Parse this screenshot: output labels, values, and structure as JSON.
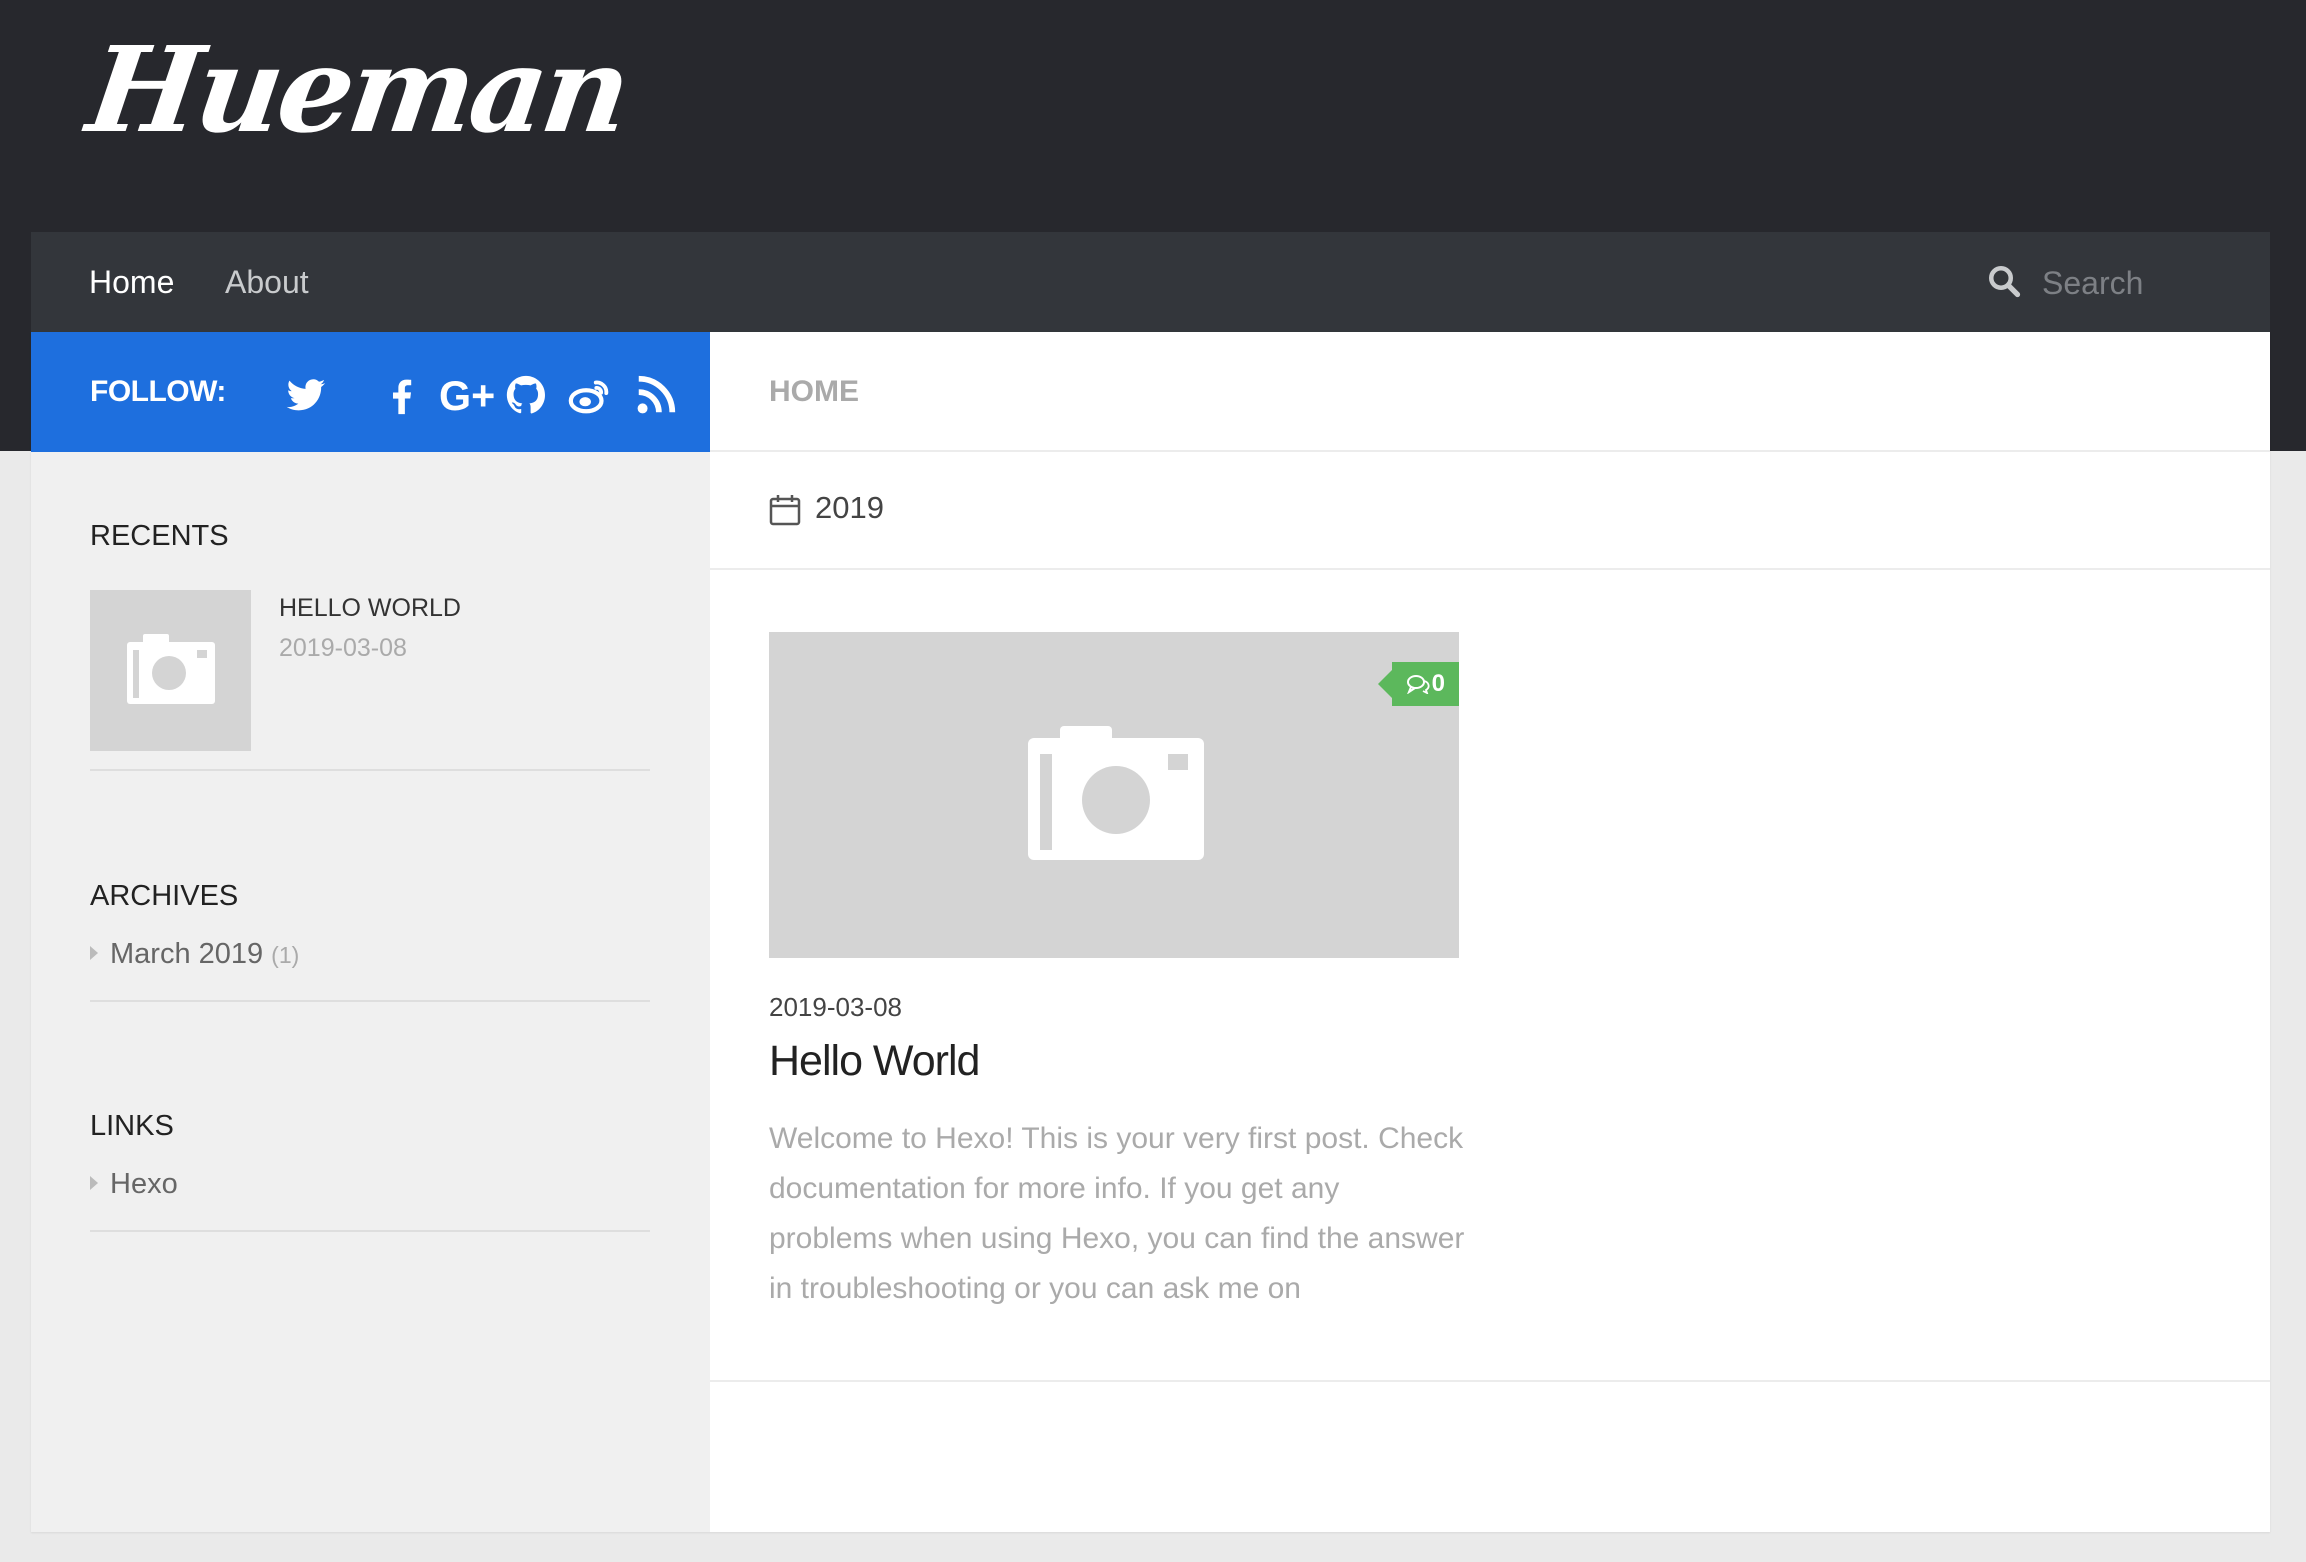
{
  "site": {
    "logo_text": "Hueman"
  },
  "nav": {
    "items": [
      {
        "label": "Home",
        "active": true
      },
      {
        "label": "About",
        "active": false
      }
    ],
    "search": {
      "placeholder": "Search",
      "value": ""
    }
  },
  "sidebar": {
    "follow": {
      "label": "FOLLOW:",
      "icons": [
        "twitter-icon",
        "facebook-icon",
        "google-plus-icon",
        "github-icon",
        "weibo-icon",
        "rss-icon"
      ]
    },
    "recents": {
      "title": "RECENTS",
      "items": [
        {
          "title": "HELLO WORLD",
          "date": "2019-03-08"
        }
      ]
    },
    "archives": {
      "title": "ARCHIVES",
      "items": [
        {
          "label": "March 2019",
          "count": "(1)"
        }
      ]
    },
    "links": {
      "title": "LINKS",
      "items": [
        {
          "label": "Hexo"
        }
      ]
    }
  },
  "main": {
    "breadcrumb": "HOME",
    "year_heading": "2019",
    "posts": [
      {
        "date": "2019-03-08",
        "title": "Hello World",
        "comments": "0",
        "excerpt": "Welcome to Hexo! This is your very first post. Check documentation for more info. If you get any problems when using Hexo, you can find the answer in troubleshooting or you can ask me on"
      }
    ]
  },
  "colors": {
    "header_bg": "#27282d",
    "nav_bg": "#33363b",
    "follow_bg": "#1e6fde",
    "comment_badge": "#5cb85c",
    "placeholder_gray": "#d4d4d4"
  }
}
